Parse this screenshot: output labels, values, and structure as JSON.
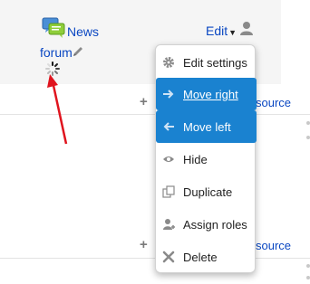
{
  "activity": {
    "link_line1": "News",
    "link_line2": "forum"
  },
  "edit_menu": {
    "toggle_label": "Edit",
    "items": [
      {
        "label": "Edit settings",
        "icon": "gear-icon"
      },
      {
        "label": "Move right",
        "icon": "arrow-right-icon"
      },
      {
        "label": "Move left",
        "icon": "arrow-left-icon"
      },
      {
        "label": "Hide",
        "icon": "eye-icon"
      },
      {
        "label": "Duplicate",
        "icon": "duplicate-icon"
      },
      {
        "label": "Assign roles",
        "icon": "assign-roles-icon"
      },
      {
        "label": "Delete",
        "icon": "delete-icon"
      }
    ]
  },
  "section": {
    "add_link_partial": "source"
  },
  "colors": {
    "link": "#0a47c2",
    "highlight": "#1a82d0",
    "arrow": "#e0141e"
  }
}
